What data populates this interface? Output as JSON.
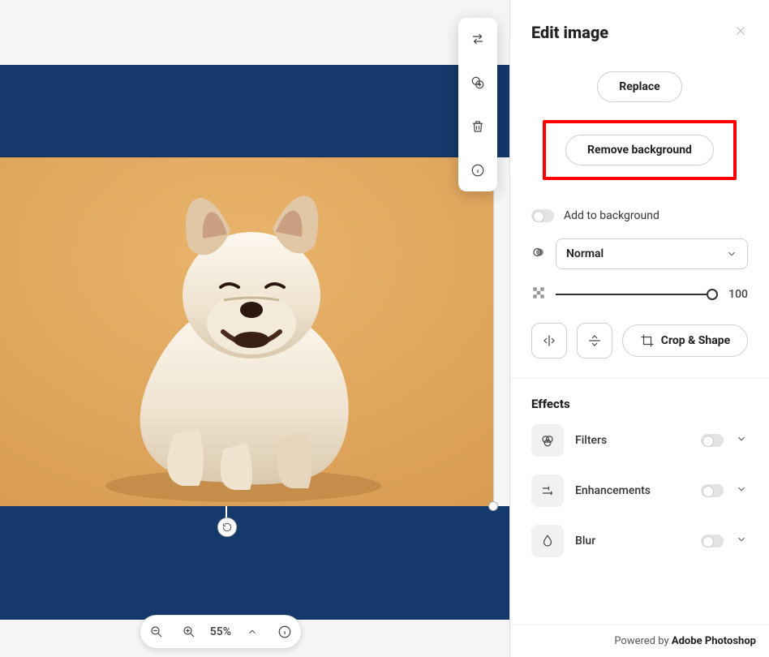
{
  "panel": {
    "title": "Edit image",
    "replace_label": "Replace",
    "remove_bg_label": "Remove background",
    "add_to_bg_label": "Add to background",
    "blend_mode": "Normal",
    "opacity_value": "100",
    "crop_shape_label": "Crop & Shape"
  },
  "effects": {
    "section_title": "Effects",
    "filters_label": "Filters",
    "enhancements_label": "Enhancements",
    "blur_label": "Blur"
  },
  "zoom": {
    "level": "55%"
  },
  "footer": {
    "prefix": "Powered by ",
    "brand": "Adobe Photoshop"
  }
}
